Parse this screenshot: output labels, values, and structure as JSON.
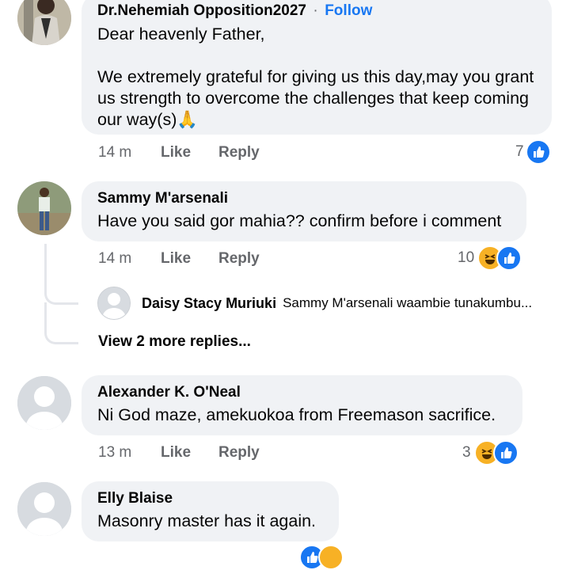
{
  "comments": [
    {
      "author": "Dr.Nehemiah Opposition2027",
      "follow_separator": "·",
      "follow_label": "Follow",
      "text": "Dear heavenly Father,\n\nWe extremely grateful for giving us this day,may you grant us strength to overcome the challenges that keep coming our way(s)🙏",
      "time": "14 m",
      "like_label": "Like",
      "reply_label": "Reply",
      "reaction_count": "7",
      "reactions": [
        "like-icon"
      ]
    },
    {
      "author": "Sammy M'arsenali",
      "text": "Have you said gor mahia?? confirm before i comment",
      "time": "14 m",
      "like_label": "Like",
      "reply_label": "Reply",
      "reaction_count": "10",
      "reactions": [
        "haha-icon",
        "like-icon"
      ],
      "reply_preview": {
        "author": "Daisy Stacy Muriuki",
        "snippet": "Sammy M'arsenali waambie tunakumbu..."
      },
      "view_more": "View 2 more replies..."
    },
    {
      "author": "Alexander K. O'Neal",
      "text": "Ni God maze, amekuokoa from Freemason sacrifice.",
      "time": "13 m",
      "like_label": "Like",
      "reply_label": "Reply",
      "reaction_count": "3",
      "reactions": [
        "haha-icon",
        "like-icon"
      ]
    },
    {
      "author": "Elly Blaise",
      "text": "Masonry master has it again.",
      "reactions": [
        "like-icon",
        "haha-icon"
      ]
    }
  ],
  "colors": {
    "accent": "#1877f2",
    "bubble": "#f0f2f5",
    "muted": "#65676b",
    "haha": "#f7b125"
  }
}
